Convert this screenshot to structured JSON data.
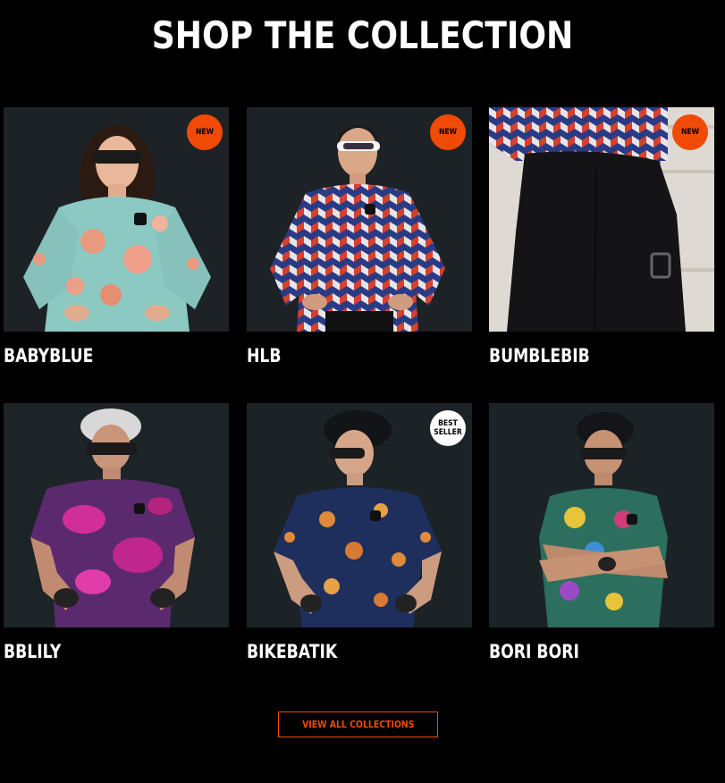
{
  "section": {
    "title": "SHOP THE COLLECTION",
    "cta_label": "VIEW ALL COLLECTIONS"
  },
  "colors": {
    "background": "#000000",
    "accent": "#f04a06",
    "text": "#ffffff"
  },
  "products": [
    {
      "name": "BABYBLUE",
      "badge": "NEW",
      "image": "woman-in-batik-long-sleeve-jersey-photo"
    },
    {
      "name": "HLB",
      "badge": "NEW",
      "image": "man-in-geometric-long-sleeve-jersey-photo"
    },
    {
      "name": "BUMBLEBIB",
      "badge": "NEW",
      "image": "black-bib-shorts-closeup-photo"
    },
    {
      "name": "BBLILY",
      "badge": "",
      "image": "man-in-pink-floral-jersey-photo"
    },
    {
      "name": "BIKEBATIK",
      "badge": "BEST SELLER",
      "image": "woman-in-navy-batik-jersey-photo"
    },
    {
      "name": "BORI BORI",
      "badge": "",
      "image": "man-in-paisley-jersey-photo"
    }
  ]
}
